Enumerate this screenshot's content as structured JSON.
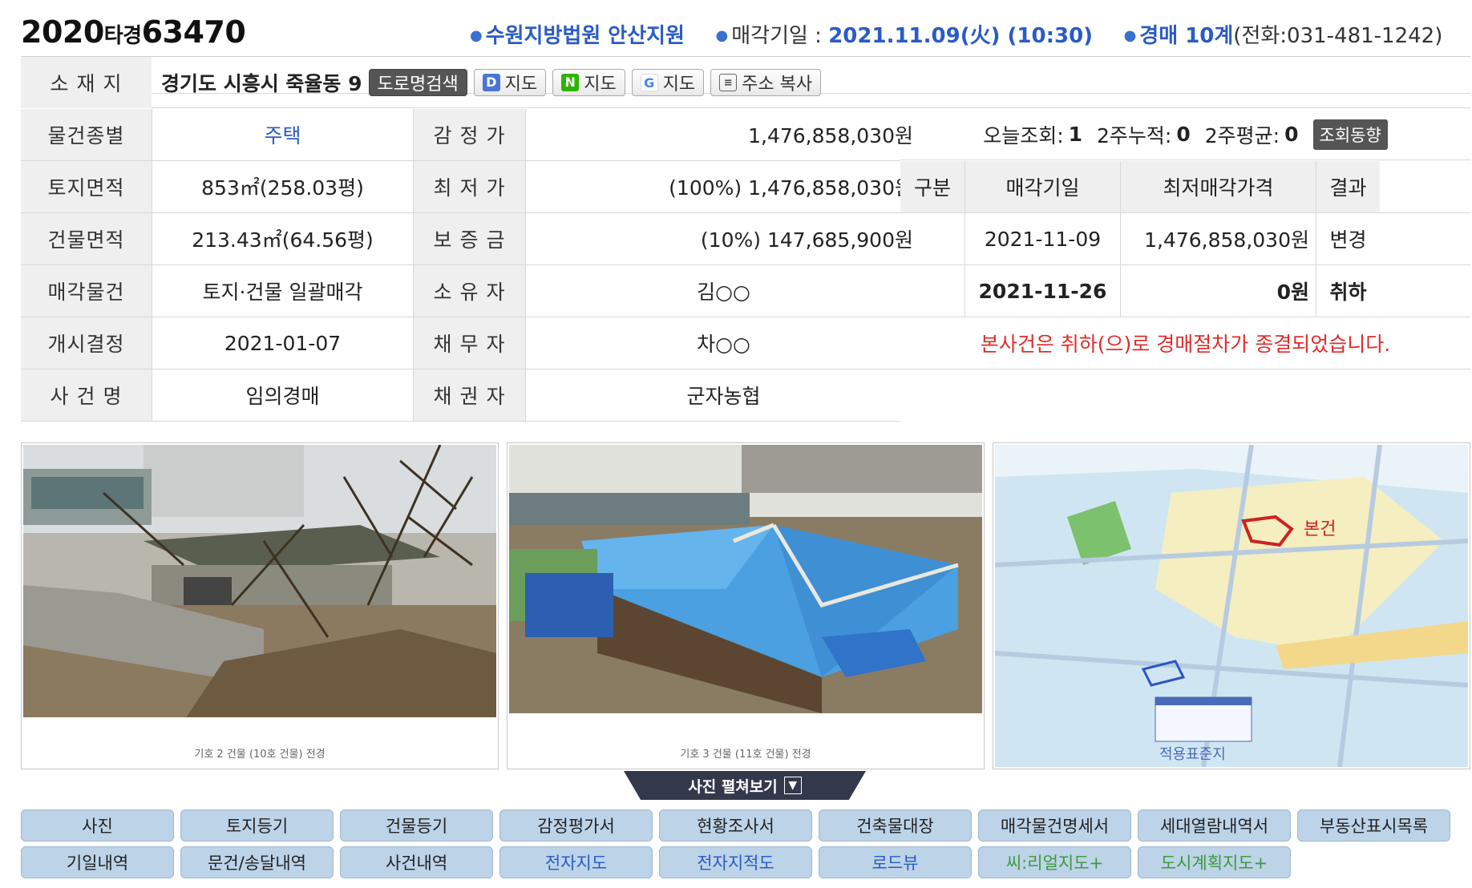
{
  "header": {
    "case_year": "2020",
    "case_type": "타경",
    "case_num": "63470",
    "court": "수원지방법원 안산지원",
    "sale_date_label": "매각기일 : ",
    "sale_date": "2021.11.09(火) (10:30)",
    "dept": "경매 10계",
    "phone": "(전화:031-481-1242)"
  },
  "address": {
    "label": "소 재 지",
    "value": "경기도 시흥시 죽율동 9",
    "buttons": {
      "road": "도로명검색",
      "daum": "지도",
      "naver": "지도",
      "google": "지도",
      "copy": "주소 복사"
    }
  },
  "info_rows": [
    {
      "l1": "물건종별",
      "v1": "주택",
      "l2": "감 정 가",
      "v2": "1,476,858,030원"
    },
    {
      "l1": "토지면적",
      "v1": "853㎡(258.03평)",
      "l2": "최 저 가",
      "v2": "(100%) 1,476,858,030원"
    },
    {
      "l1": "건물면적",
      "v1": "213.43㎡(64.56평)",
      "l2": "보 증 금",
      "v2": "(10%) 147,685,900원"
    },
    {
      "l1": "매각물건",
      "v1": "토지·건물 일괄매각",
      "l2": "소 유 자",
      "v2": "김○○"
    },
    {
      "l1": "개시결정",
      "v1": "2021-01-07",
      "l2": "채 무 자",
      "v2": "차○○"
    },
    {
      "l1": "사 건 명",
      "v1": "임의경매",
      "l2": "채 권 자",
      "v2": "군자농협"
    }
  ],
  "stats": {
    "today_label": "오늘조회:",
    "today": "1",
    "two_week_label": "2주누적:",
    "two_week": "0",
    "avg_label": "2주평균:",
    "avg": "0",
    "trend_btn": "조회동향"
  },
  "history": {
    "headers": [
      "구분",
      "매각기일",
      "최저매각가격",
      "결과"
    ],
    "rows": [
      {
        "kind": "",
        "date": "2021-11-09",
        "price": "1,476,858,030원",
        "result": "변경"
      },
      {
        "kind": "",
        "date": "2021-11-26",
        "price": "0원",
        "result": "취하"
      }
    ],
    "notice": "본사건은 취하(으)로 경매절차가 종결되었습니다."
  },
  "photos": {
    "cap1": "기호 2 건물 (10호 건물) 전경",
    "cap2": "기호 3 건물 (11호 건물) 전경",
    "map_label": "본건",
    "map_bottom": "적용표준지",
    "unfold": "사진 펼쳐보기"
  },
  "tabs_row1": [
    "사진",
    "토지등기",
    "건물등기",
    "감정평가서",
    "현황조사서",
    "건축물대장",
    "매각물건명세서",
    "세대열람내역서",
    "부동산표시목록"
  ],
  "tabs_row2": [
    "기일내역",
    "문건/송달내역",
    "사건내역",
    "전자지도",
    "전자지적도",
    "로드뷰",
    "씨:리얼지도+",
    "도시계획지도+"
  ]
}
